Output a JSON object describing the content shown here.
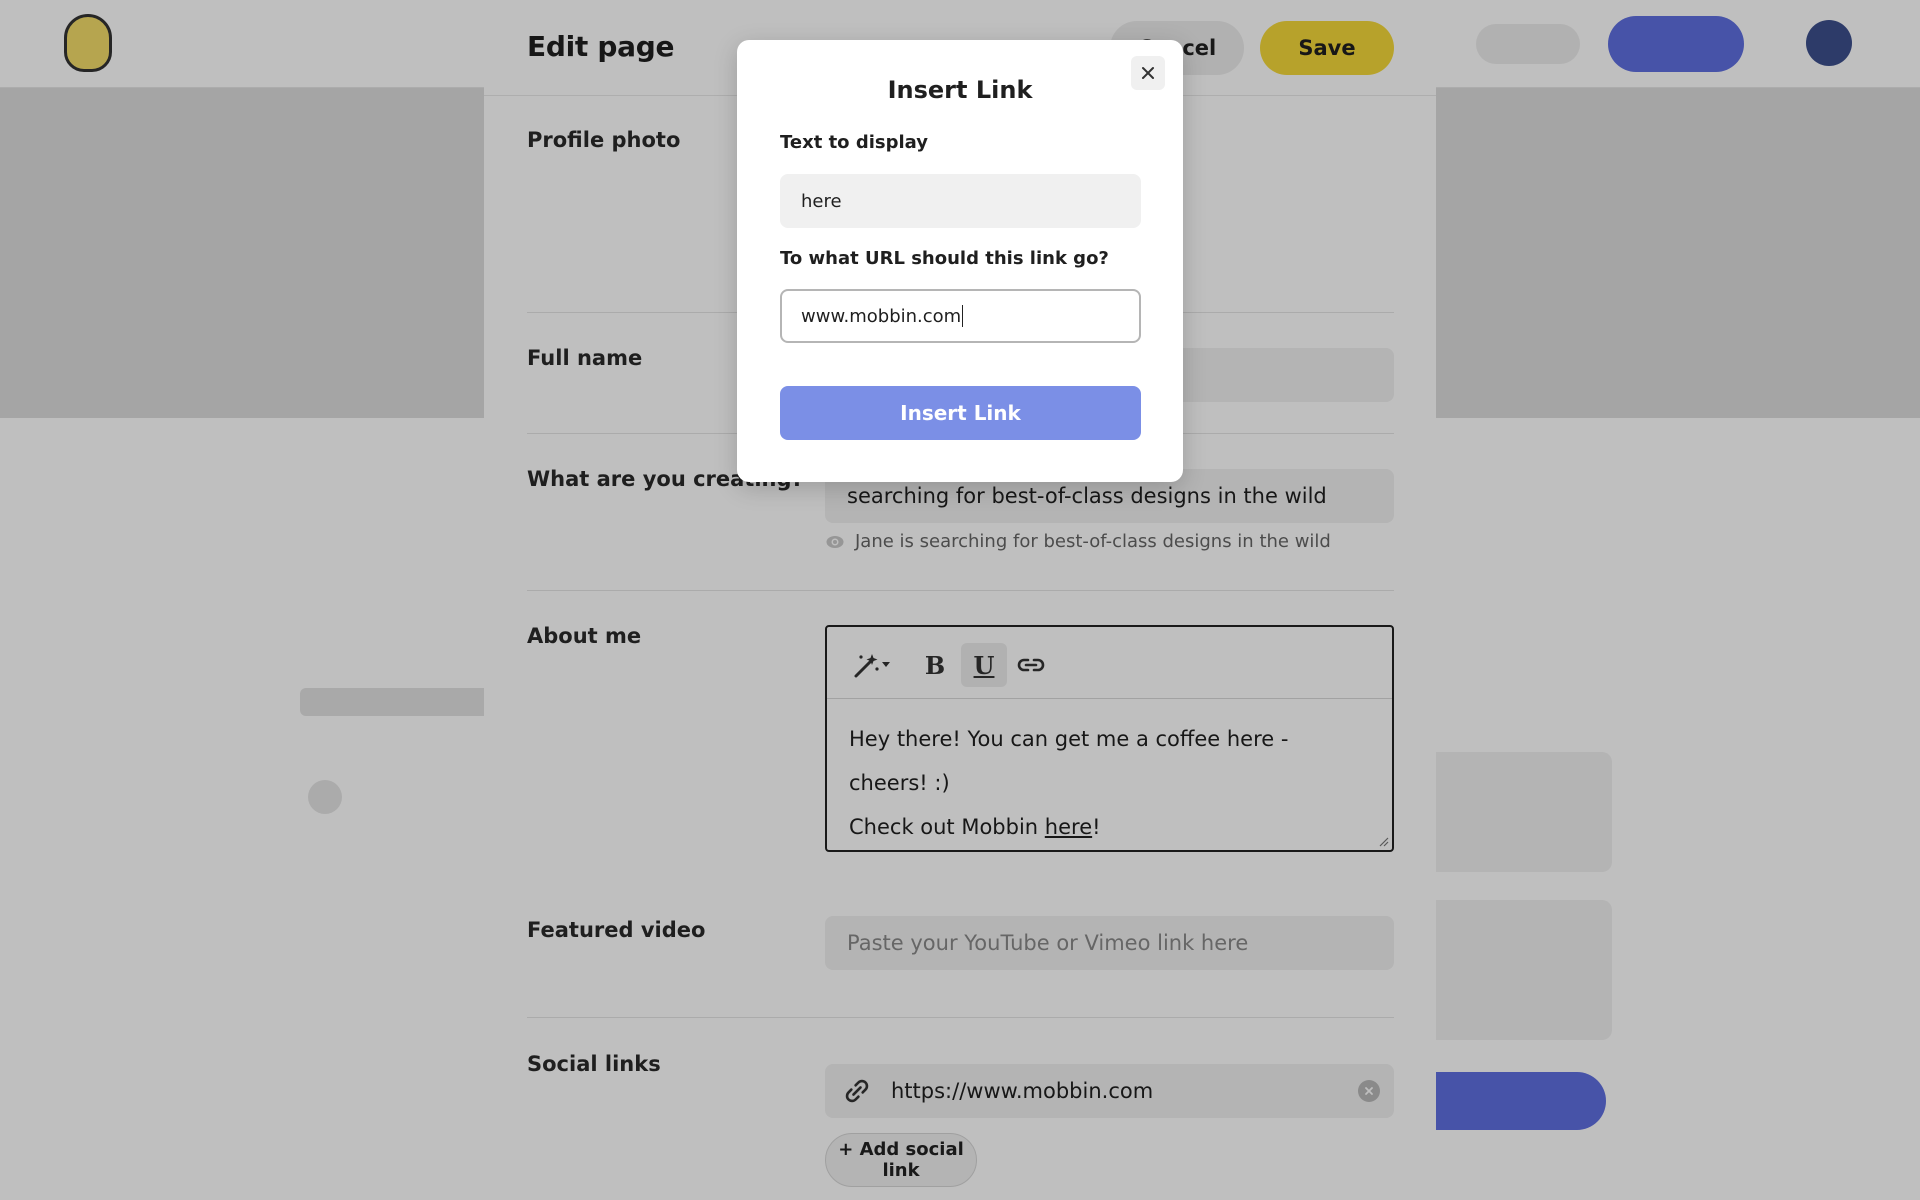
{
  "edit_page": {
    "title": "Edit page",
    "cancel_label": "Cancel",
    "save_label": "Save"
  },
  "sections": {
    "profile_photo": "Profile photo",
    "full_name": "Full name",
    "creating": "What are you creating?",
    "about_me": "About me",
    "featured_video": "Featured video",
    "social_links": "Social links"
  },
  "creating_field": {
    "value": "searching for best-of-class designs in the wild",
    "preview_text": "Jane is searching for best-of-class designs in the wild"
  },
  "about_editor": {
    "line1": "Hey there! You can get me a coffee here - cheers! :)",
    "line2_prefix": "Check out Mobbin ",
    "line2_link": "here",
    "line2_suffix": "!",
    "toolbar": {
      "magic_icon": "magic-wand-icon",
      "bold_label": "B",
      "underline_label": "U",
      "link_icon": "link-icon"
    }
  },
  "featured_video": {
    "placeholder": "Paste your YouTube or Vimeo link here"
  },
  "social": {
    "link_value": "https://www.mobbin.com",
    "add_label": "+ Add social link"
  },
  "modal": {
    "title": "Insert Link",
    "text_label": "Text to display",
    "text_value": "here",
    "url_label": "To what URL should this link go?",
    "url_value": "www.mobbin.com",
    "insert_label": "Insert Link",
    "close_icon": "close-icon"
  },
  "colors": {
    "save": "#f4d93a",
    "insert_button": "#7b8fe6",
    "primary": "#5f6fe0"
  }
}
